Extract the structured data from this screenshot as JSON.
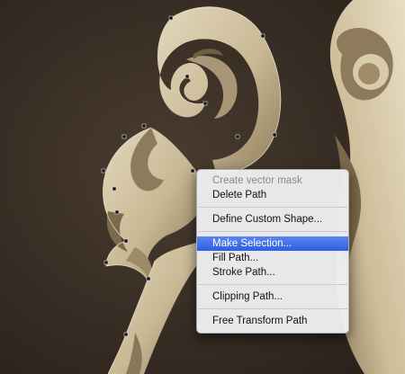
{
  "context_menu": {
    "groups": [
      {
        "items": [
          {
            "label": "Create vector mask",
            "enabled": false
          },
          {
            "label": "Delete Path",
            "enabled": true
          }
        ]
      },
      {
        "items": [
          {
            "label": "Define Custom Shape...",
            "enabled": true
          }
        ]
      },
      {
        "items": [
          {
            "label": "Make Selection...",
            "enabled": true,
            "highlighted": true
          },
          {
            "label": "Fill Path...",
            "enabled": true
          },
          {
            "label": "Stroke Path...",
            "enabled": true
          }
        ]
      },
      {
        "items": [
          {
            "label": "Clipping Path...",
            "enabled": true
          }
        ]
      },
      {
        "items": [
          {
            "label": "Free Transform Path",
            "enabled": true
          }
        ]
      }
    ]
  },
  "colors": {
    "background": "#3a3027",
    "wood_light": "#d8ccaf",
    "wood_shadow": "#8d7d60",
    "menu_highlight": "#3b68e8"
  }
}
